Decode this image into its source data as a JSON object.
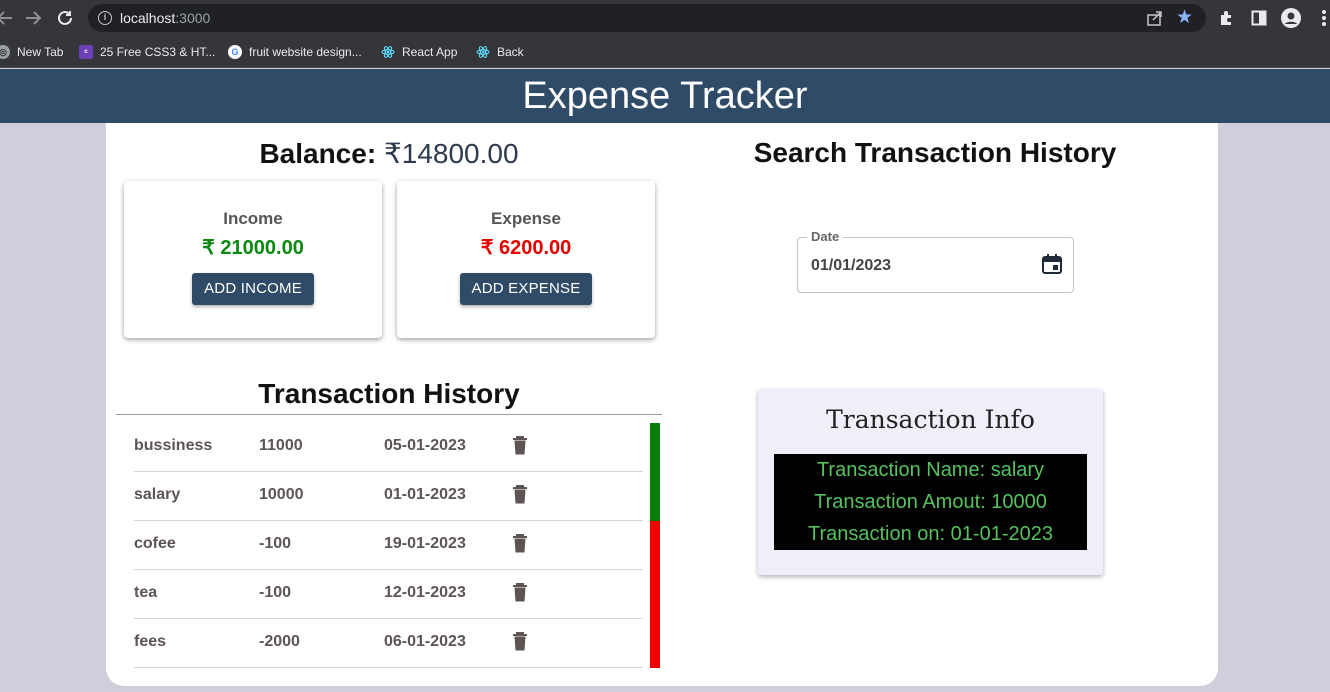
{
  "browser": {
    "url_host": "localhost",
    "url_port": ":3000",
    "bookmarks": [
      {
        "label": "New Tab",
        "icon": "globe-icon"
      },
      {
        "label": "25 Free CSS3 & HT...",
        "icon": "colorlib-icon"
      },
      {
        "label": "fruit website design...",
        "icon": "google-icon"
      },
      {
        "label": "React App",
        "icon": "react-icon"
      },
      {
        "label": "Back",
        "icon": "react-icon"
      }
    ]
  },
  "app": {
    "title": "Expense Tracker",
    "header_color": "#2f4b67"
  },
  "balance": {
    "label": "Balance:",
    "amount": "₹14800.00"
  },
  "income": {
    "label": "Income",
    "amount": "₹ 21000.00",
    "button": "ADD INCOME",
    "color": "#0b8a12"
  },
  "expense": {
    "label": "Expense",
    "amount": "₹ 6200.00",
    "button": "ADD EXPENSE",
    "color": "#e60000"
  },
  "history": {
    "title": "Transaction History",
    "rows": [
      {
        "name": "bussiness",
        "amount": "11000",
        "date": "05-01-2023",
        "type": "income"
      },
      {
        "name": "salary",
        "amount": "10000",
        "date": "01-01-2023",
        "type": "income"
      },
      {
        "name": "cofee",
        "amount": "-100",
        "date": "19-01-2023",
        "type": "expense"
      },
      {
        "name": "tea",
        "amount": "-100",
        "date": "12-01-2023",
        "type": "expense"
      },
      {
        "name": "fees",
        "amount": "-2000",
        "date": "06-01-2023",
        "type": "expense"
      }
    ]
  },
  "search": {
    "title": "Search Transaction History",
    "date_label": "Date",
    "date_value": "01/01/2023"
  },
  "info": {
    "title": "Transaction Info",
    "name_line": "Transaction Name: salary",
    "amount_line": "Transaction Amout: 10000",
    "date_line": "Transaction on: 01-01-2023"
  }
}
